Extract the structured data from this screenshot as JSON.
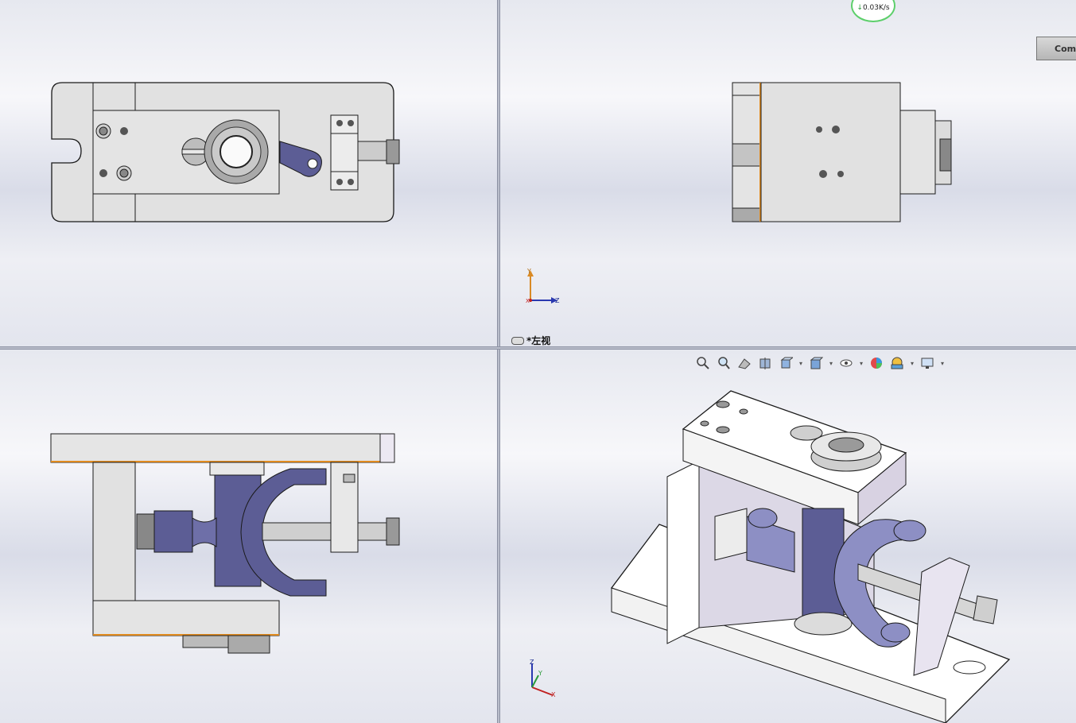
{
  "viewports": {
    "top_left": {
      "name": "front-view"
    },
    "top_right": {
      "name": "left-view",
      "label": "*左视"
    },
    "bottom_left": {
      "name": "top-view"
    },
    "bottom_right": {
      "name": "isometric-view"
    }
  },
  "network_badge": {
    "speed": "0.03K/s"
  },
  "overlay_button": {
    "label": "Com"
  },
  "triad_top_right": {
    "axis_up": "Y",
    "axis_right": "Z",
    "axis_origin": "X"
  },
  "triad_iso": {
    "axis_up": "Z",
    "axis_right": "X",
    "axis_side": "Y"
  },
  "hud_toolbar": {
    "items": [
      "zoom-to-fit-icon",
      "zoom-to-area-icon",
      "previous-view-icon",
      "section-view-icon",
      "view-orientation-icon",
      "display-style-icon",
      "hide-show-items-icon",
      "edit-appearance-icon",
      "apply-scene-icon",
      "view-settings-icon"
    ]
  },
  "colors": {
    "part_grey": "#e1e1e1",
    "part_outline": "#202020",
    "linkage_purple": "#5c5d95",
    "linkage_light": "#8d8fc4",
    "edge_orange": "#e08a1e",
    "viewport_border": "#8c91a3"
  }
}
